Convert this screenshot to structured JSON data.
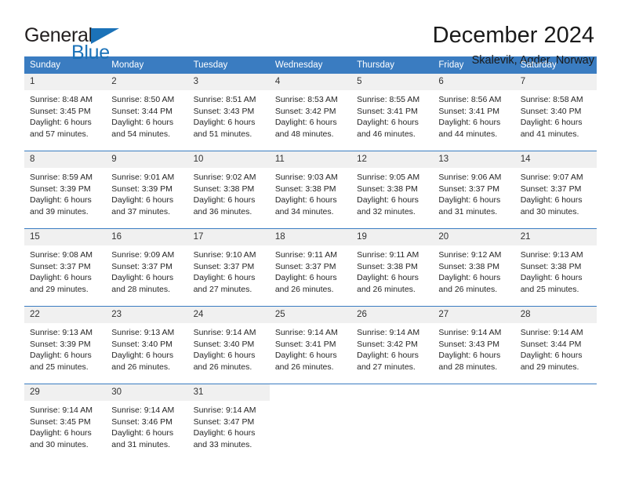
{
  "brand": {
    "name_top": "General",
    "name_bottom": "Blue",
    "triangle_color": "#1b72b8",
    "text_color": "#231f20"
  },
  "header": {
    "title": "December 2024",
    "subtitle": "Skalevik, Agder, Norway"
  },
  "theme": {
    "header_row_bg": "#3a7cc1",
    "header_row_text": "#ffffff",
    "daynum_bg": "#f0f0f0",
    "row_divider": "#3a7cc1",
    "page_bg": "#ffffff"
  },
  "weekdays": [
    "Sunday",
    "Monday",
    "Tuesday",
    "Wednesday",
    "Thursday",
    "Friday",
    "Saturday"
  ],
  "weeks": [
    [
      {
        "day": "1",
        "sunrise": "Sunrise: 8:48 AM",
        "sunset": "Sunset: 3:45 PM",
        "daylight1": "Daylight: 6 hours",
        "daylight2": "and 57 minutes."
      },
      {
        "day": "2",
        "sunrise": "Sunrise: 8:50 AM",
        "sunset": "Sunset: 3:44 PM",
        "daylight1": "Daylight: 6 hours",
        "daylight2": "and 54 minutes."
      },
      {
        "day": "3",
        "sunrise": "Sunrise: 8:51 AM",
        "sunset": "Sunset: 3:43 PM",
        "daylight1": "Daylight: 6 hours",
        "daylight2": "and 51 minutes."
      },
      {
        "day": "4",
        "sunrise": "Sunrise: 8:53 AM",
        "sunset": "Sunset: 3:42 PM",
        "daylight1": "Daylight: 6 hours",
        "daylight2": "and 48 minutes."
      },
      {
        "day": "5",
        "sunrise": "Sunrise: 8:55 AM",
        "sunset": "Sunset: 3:41 PM",
        "daylight1": "Daylight: 6 hours",
        "daylight2": "and 46 minutes."
      },
      {
        "day": "6",
        "sunrise": "Sunrise: 8:56 AM",
        "sunset": "Sunset: 3:41 PM",
        "daylight1": "Daylight: 6 hours",
        "daylight2": "and 44 minutes."
      },
      {
        "day": "7",
        "sunrise": "Sunrise: 8:58 AM",
        "sunset": "Sunset: 3:40 PM",
        "daylight1": "Daylight: 6 hours",
        "daylight2": "and 41 minutes."
      }
    ],
    [
      {
        "day": "8",
        "sunrise": "Sunrise: 8:59 AM",
        "sunset": "Sunset: 3:39 PM",
        "daylight1": "Daylight: 6 hours",
        "daylight2": "and 39 minutes."
      },
      {
        "day": "9",
        "sunrise": "Sunrise: 9:01 AM",
        "sunset": "Sunset: 3:39 PM",
        "daylight1": "Daylight: 6 hours",
        "daylight2": "and 37 minutes."
      },
      {
        "day": "10",
        "sunrise": "Sunrise: 9:02 AM",
        "sunset": "Sunset: 3:38 PM",
        "daylight1": "Daylight: 6 hours",
        "daylight2": "and 36 minutes."
      },
      {
        "day": "11",
        "sunrise": "Sunrise: 9:03 AM",
        "sunset": "Sunset: 3:38 PM",
        "daylight1": "Daylight: 6 hours",
        "daylight2": "and 34 minutes."
      },
      {
        "day": "12",
        "sunrise": "Sunrise: 9:05 AM",
        "sunset": "Sunset: 3:38 PM",
        "daylight1": "Daylight: 6 hours",
        "daylight2": "and 32 minutes."
      },
      {
        "day": "13",
        "sunrise": "Sunrise: 9:06 AM",
        "sunset": "Sunset: 3:37 PM",
        "daylight1": "Daylight: 6 hours",
        "daylight2": "and 31 minutes."
      },
      {
        "day": "14",
        "sunrise": "Sunrise: 9:07 AM",
        "sunset": "Sunset: 3:37 PM",
        "daylight1": "Daylight: 6 hours",
        "daylight2": "and 30 minutes."
      }
    ],
    [
      {
        "day": "15",
        "sunrise": "Sunrise: 9:08 AM",
        "sunset": "Sunset: 3:37 PM",
        "daylight1": "Daylight: 6 hours",
        "daylight2": "and 29 minutes."
      },
      {
        "day": "16",
        "sunrise": "Sunrise: 9:09 AM",
        "sunset": "Sunset: 3:37 PM",
        "daylight1": "Daylight: 6 hours",
        "daylight2": "and 28 minutes."
      },
      {
        "day": "17",
        "sunrise": "Sunrise: 9:10 AM",
        "sunset": "Sunset: 3:37 PM",
        "daylight1": "Daylight: 6 hours",
        "daylight2": "and 27 minutes."
      },
      {
        "day": "18",
        "sunrise": "Sunrise: 9:11 AM",
        "sunset": "Sunset: 3:37 PM",
        "daylight1": "Daylight: 6 hours",
        "daylight2": "and 26 minutes."
      },
      {
        "day": "19",
        "sunrise": "Sunrise: 9:11 AM",
        "sunset": "Sunset: 3:38 PM",
        "daylight1": "Daylight: 6 hours",
        "daylight2": "and 26 minutes."
      },
      {
        "day": "20",
        "sunrise": "Sunrise: 9:12 AM",
        "sunset": "Sunset: 3:38 PM",
        "daylight1": "Daylight: 6 hours",
        "daylight2": "and 26 minutes."
      },
      {
        "day": "21",
        "sunrise": "Sunrise: 9:13 AM",
        "sunset": "Sunset: 3:38 PM",
        "daylight1": "Daylight: 6 hours",
        "daylight2": "and 25 minutes."
      }
    ],
    [
      {
        "day": "22",
        "sunrise": "Sunrise: 9:13 AM",
        "sunset": "Sunset: 3:39 PM",
        "daylight1": "Daylight: 6 hours",
        "daylight2": "and 25 minutes."
      },
      {
        "day": "23",
        "sunrise": "Sunrise: 9:13 AM",
        "sunset": "Sunset: 3:40 PM",
        "daylight1": "Daylight: 6 hours",
        "daylight2": "and 26 minutes."
      },
      {
        "day": "24",
        "sunrise": "Sunrise: 9:14 AM",
        "sunset": "Sunset: 3:40 PM",
        "daylight1": "Daylight: 6 hours",
        "daylight2": "and 26 minutes."
      },
      {
        "day": "25",
        "sunrise": "Sunrise: 9:14 AM",
        "sunset": "Sunset: 3:41 PM",
        "daylight1": "Daylight: 6 hours",
        "daylight2": "and 26 minutes."
      },
      {
        "day": "26",
        "sunrise": "Sunrise: 9:14 AM",
        "sunset": "Sunset: 3:42 PM",
        "daylight1": "Daylight: 6 hours",
        "daylight2": "and 27 minutes."
      },
      {
        "day": "27",
        "sunrise": "Sunrise: 9:14 AM",
        "sunset": "Sunset: 3:43 PM",
        "daylight1": "Daylight: 6 hours",
        "daylight2": "and 28 minutes."
      },
      {
        "day": "28",
        "sunrise": "Sunrise: 9:14 AM",
        "sunset": "Sunset: 3:44 PM",
        "daylight1": "Daylight: 6 hours",
        "daylight2": "and 29 minutes."
      }
    ],
    [
      {
        "day": "29",
        "sunrise": "Sunrise: 9:14 AM",
        "sunset": "Sunset: 3:45 PM",
        "daylight1": "Daylight: 6 hours",
        "daylight2": "and 30 minutes."
      },
      {
        "day": "30",
        "sunrise": "Sunrise: 9:14 AM",
        "sunset": "Sunset: 3:46 PM",
        "daylight1": "Daylight: 6 hours",
        "daylight2": "and 31 minutes."
      },
      {
        "day": "31",
        "sunrise": "Sunrise: 9:14 AM",
        "sunset": "Sunset: 3:47 PM",
        "daylight1": "Daylight: 6 hours",
        "daylight2": "and 33 minutes."
      },
      {
        "day": "",
        "sunrise": "",
        "sunset": "",
        "daylight1": "",
        "daylight2": ""
      },
      {
        "day": "",
        "sunrise": "",
        "sunset": "",
        "daylight1": "",
        "daylight2": ""
      },
      {
        "day": "",
        "sunrise": "",
        "sunset": "",
        "daylight1": "",
        "daylight2": ""
      },
      {
        "day": "",
        "sunrise": "",
        "sunset": "",
        "daylight1": "",
        "daylight2": ""
      }
    ]
  ]
}
